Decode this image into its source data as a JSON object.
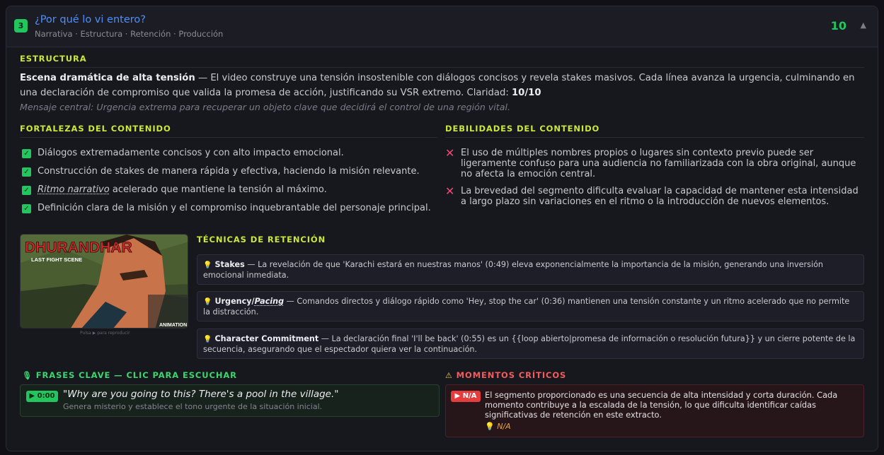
{
  "header": {
    "number": "3",
    "title": "¿Por qué lo vi entero?",
    "subtitle": "Narrativa · Estructura · Retención · Producción",
    "score": "10",
    "collapse_icon": "chevron-up-icon"
  },
  "estructura": {
    "heading": "ESTRUCTURA",
    "lead": "Escena dramática de alta tensión",
    "body": " — El video construye una tensión insostenible con diálogos concisos y revela stakes masivos. Cada línea avanza la urgencia, culminando en una declaración de compromiso que valida la promesa de acción, justificando su VSR extremo. Claridad: ",
    "claridad": "10/10",
    "central": "Mensaje central: Urgencia extrema para recuperar un objeto clave que decidirá el control de una región vital."
  },
  "fortalezas": {
    "heading": "FORTALEZAS DEL CONTENIDO",
    "items": [
      {
        "text": "Diálogos extremadamente concisos y con alto impacto emocional."
      },
      {
        "text": "Construcción de stakes de manera rápida y efectiva, haciendo la misión relevante."
      },
      {
        "ital": "Ritmo narrativo",
        "text": " acelerado que mantiene la tensión al máximo."
      },
      {
        "text": "Definición clara de la misión y el compromiso inquebrantable del personaje principal."
      }
    ]
  },
  "debilidades": {
    "heading": "DEBILIDADES DEL CONTENIDO",
    "items": [
      "El uso de múltiples nombres propios o lugares sin contexto previo puede ser ligeramente confuso para una audiencia no familiarizada con la obra original, aunque no afecta la emoción central.",
      "La brevedad del segmento dificulta evaluar la capacidad de mantener esta intensidad a largo plazo sin variaciones en el ritmo o la introducción de nuevos elementos."
    ]
  },
  "thumbnail": {
    "title_text": "DHURANDHAR",
    "subtitle_text": "LAST FIGHT SCENE",
    "brand_text": "ANIMATION",
    "hint": "Pulsa ▶ para reproducir"
  },
  "tecnicas": {
    "heading": "TÉCNICAS DE RETENCIÓN",
    "items": [
      {
        "name": "Stakes",
        "name_ital": "",
        "text": " — La revelación de que 'Karachi estará en nuestras manos' (0:49) eleva exponencialmente la importancia de la misión, generando una inversión emocional inmediata."
      },
      {
        "name": "Urgency/",
        "name_ital": "Pacing",
        "text": " — Comandos directos y diálogo rápido como 'Hey, stop the car' (0:36) mantienen una tensión constante y un ritmo acelerado que no permite la distracción."
      },
      {
        "name": "Character Commitment",
        "name_ital": "",
        "text": " — La declaración final 'I'll be back' (0:55) es un {{loop abierto|promesa de información o resolución futura}} y un cierre potente de la secuencia, asegurando que el espectador quiera ver la continuación."
      }
    ]
  },
  "frases": {
    "heading": "FRASES CLAVE — CLIC PARA ESCUCHAR",
    "items": [
      {
        "time": "▶ 0:00",
        "quote": "\"Why are you going to this? There's a pool in the village.\"",
        "note": "Genera misterio y establece el tono urgente de la situación inicial."
      }
    ]
  },
  "momentos": {
    "heading": "MOMENTOS CRÍTICOS",
    "items": [
      {
        "badge": "▶ N/A",
        "text": "El segmento proporcionado es una secuencia de alta intensidad y corta duración. Cada momento contribuye a la escalada de la tensión, lo que dificulta identificar caídas significativas de retención en este extracto.",
        "tip": "N/A"
      }
    ]
  },
  "colors": {
    "accent_green": "#22c55e",
    "heading_lime": "#c8e83a",
    "title_blue": "#4f8ff7",
    "danger_red": "#e53d3d",
    "warning_orange": "#e8a33a"
  }
}
